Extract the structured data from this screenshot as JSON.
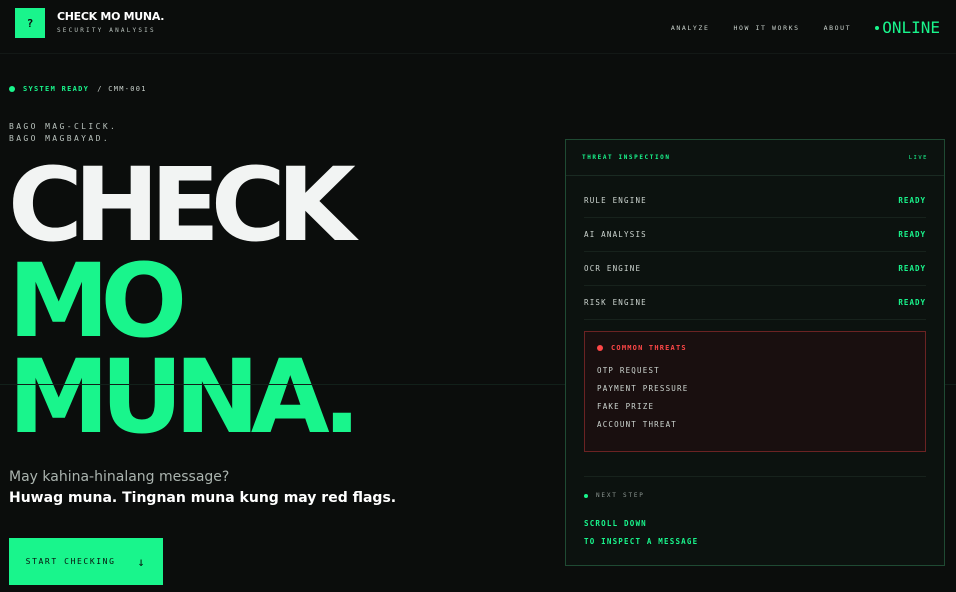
{
  "header": {
    "logo_glyph": "?",
    "brand": "CHECK MO MUNA.",
    "brand_sub": "SECURITY ANALYSIS",
    "nav": [
      "ANALYZE",
      "HOW IT WORKS",
      "ABOUT"
    ],
    "online": "ONLINE"
  },
  "status": {
    "label": "SYSTEM READY",
    "code": "/ CMM-001"
  },
  "tagline": {
    "line1": "BAGO MAG-CLICK.",
    "line2": "BAGO MAGBAYAD."
  },
  "hero": {
    "line1": "CHECK",
    "line2": "MO",
    "line3": "MUNA."
  },
  "question": "May kahina-hinalang message?",
  "advice": "Huwag muna. Tingnan muna kung may red flags.",
  "cta": {
    "label": "START CHECKING",
    "arrow": "↓"
  },
  "panel": {
    "title": "THREAT INSPECTION",
    "live": "LIVE",
    "rows": [
      {
        "name": "RULE ENGINE",
        "value": "READY"
      },
      {
        "name": "AI ANALYSIS",
        "value": "READY"
      },
      {
        "name": "OCR ENGINE",
        "value": "READY"
      },
      {
        "name": "RISK ENGINE",
        "value": "READY"
      }
    ],
    "threats": {
      "title": "COMMON THREATS",
      "items": [
        "OTP REQUEST",
        "PAYMENT PRESSURE",
        "FAKE PRIZE",
        "ACCOUNT THREAT"
      ]
    },
    "next_step": "NEXT STEP",
    "scroll_line1": "SCROLL DOWN",
    "scroll_line2": "TO INSPECT A MESSAGE"
  },
  "colors": {
    "accent": "#19f58c",
    "background": "#0b0d0c",
    "danger": "#ff4747"
  }
}
